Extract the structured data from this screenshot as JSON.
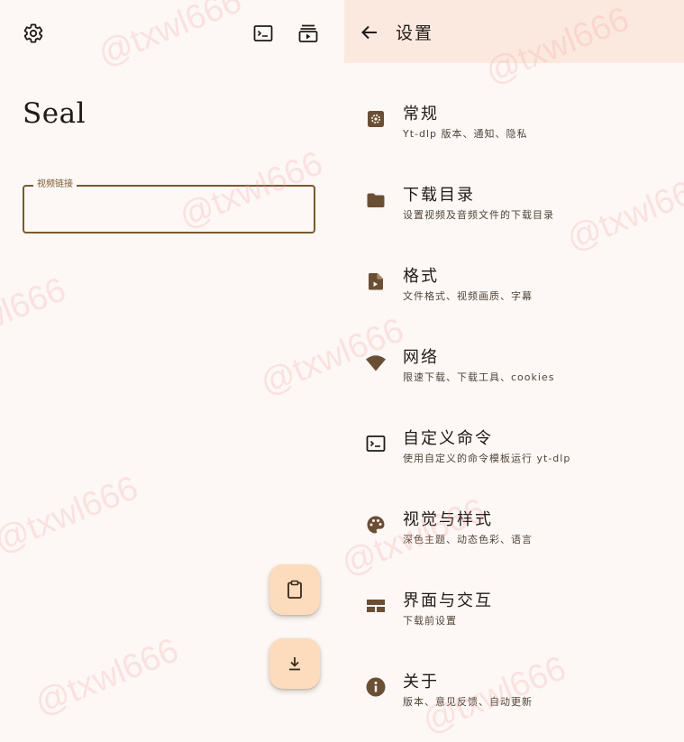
{
  "app_title": "Seal",
  "url_field": {
    "label": "视频链接",
    "value": ""
  },
  "settings_header": {
    "title": "设置"
  },
  "settings_items": [
    {
      "icon": "gear-icon",
      "title": "常规",
      "description": "Yt-dlp 版本、通知、隐私"
    },
    {
      "icon": "folder-icon",
      "title": "下载目录",
      "description": "设置视频及音频文件的下载目录"
    },
    {
      "icon": "file-video-icon",
      "title": "格式",
      "description": "文件格式、视频画质、字幕"
    },
    {
      "icon": "wifi-icon",
      "title": "网络",
      "description": "限速下载、下载工具、cookies"
    },
    {
      "icon": "terminal-icon",
      "title": "自定义命令",
      "description": "使用自定义的命令模板运行 yt-dlp"
    },
    {
      "icon": "palette-icon",
      "title": "视觉与样式",
      "description": "深色主题、动态色彩、语言"
    },
    {
      "icon": "layout-icon",
      "title": "界面与交互",
      "description": "下载前设置"
    },
    {
      "icon": "info-icon",
      "title": "关于",
      "description": "版本、意见反馈、自动更新"
    }
  ],
  "watermark": "@txwl666",
  "colors": {
    "background": "#fdf8f5",
    "header_background": "#fbe9df",
    "accent": "#7a5a2e",
    "icon": "#6b4f35",
    "fab": "#fcdcbd"
  }
}
